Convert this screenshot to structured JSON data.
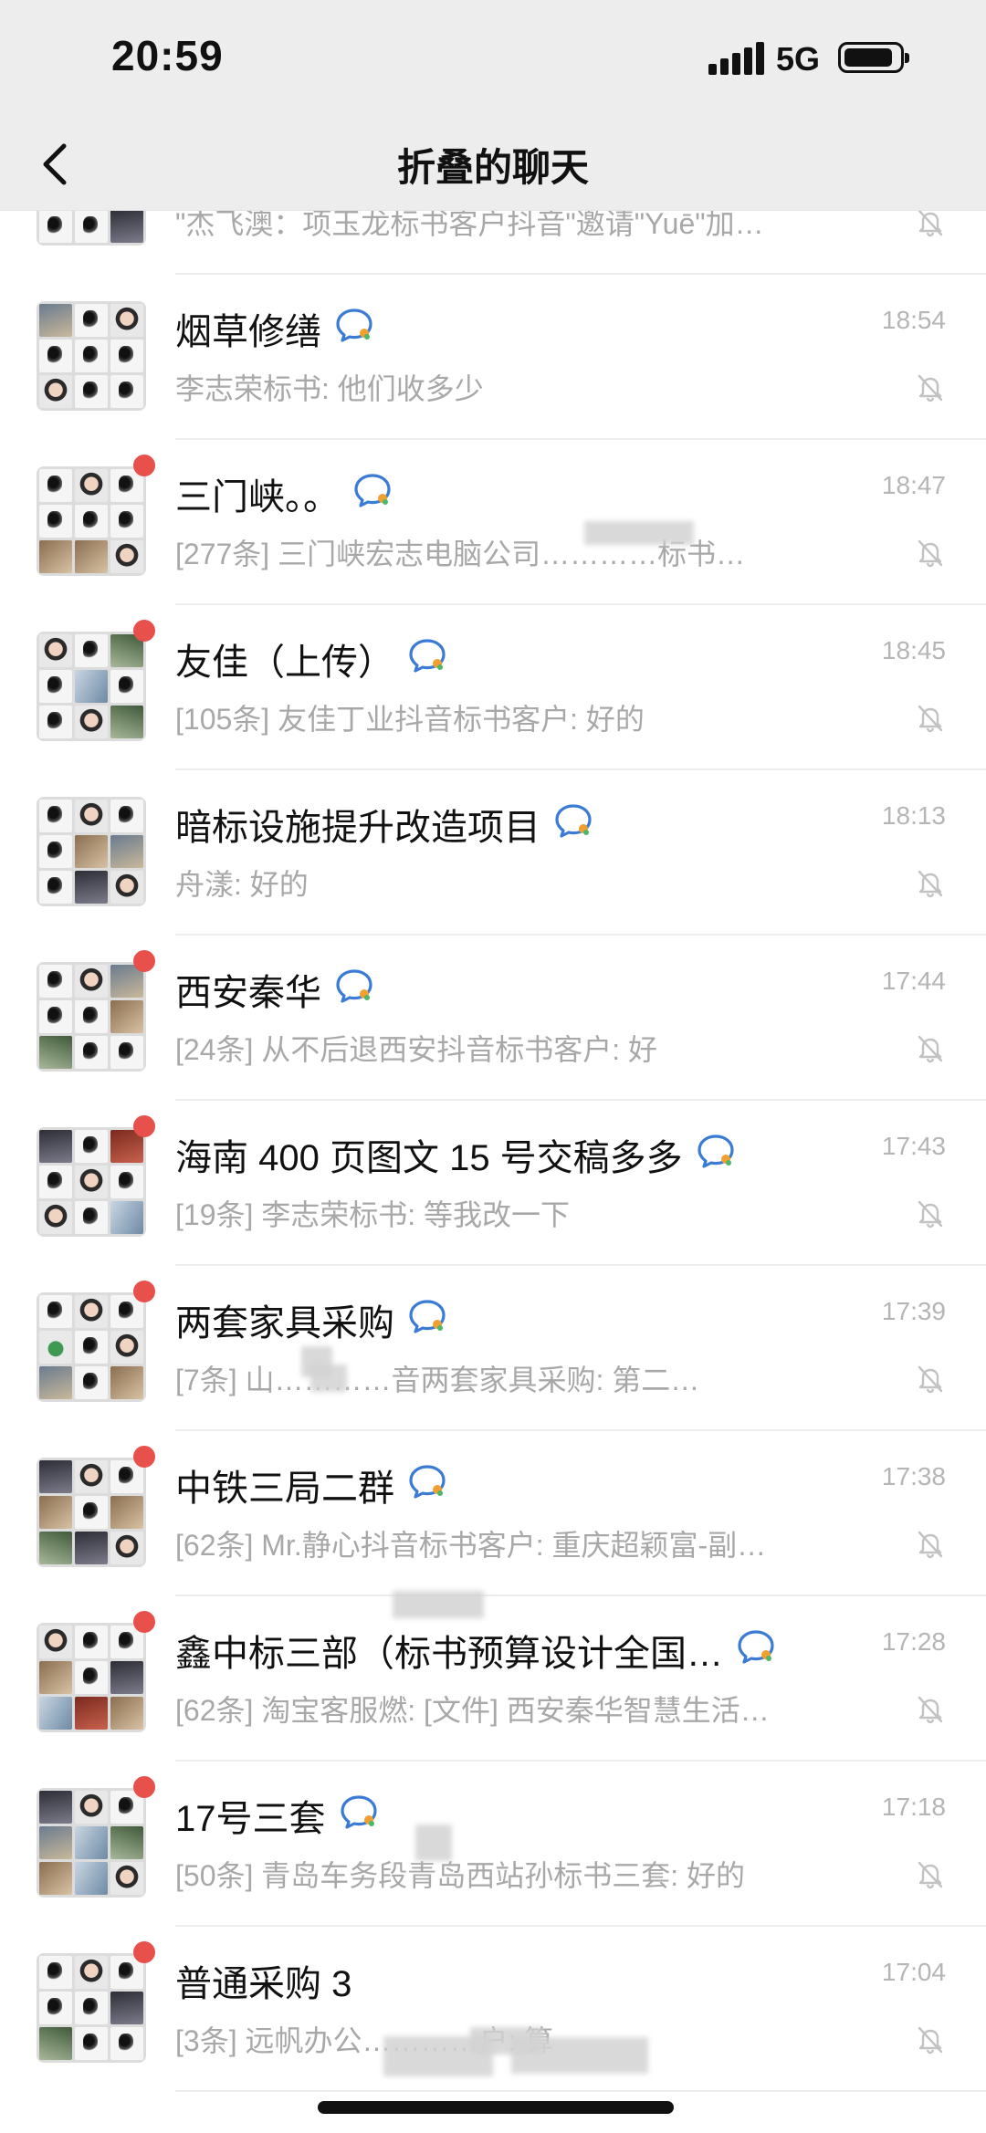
{
  "status_bar": {
    "time": "20:59",
    "network": "5G",
    "icons": [
      "signal-icon",
      "battery-icon"
    ]
  },
  "nav": {
    "title": "折叠的聊天",
    "back_icon": "chevron-left-icon"
  },
  "colors": {
    "unread_dot": "#e8514b",
    "chat_icon_blue": "#3a7bd5",
    "chat_icon_orange": "#f0a030",
    "muted_text": "#a8a8a8"
  },
  "chats": [
    {
      "title": "",
      "preview": "\"杰飞澳：项玉龙标书客户抖音\"邀请\"Yuē\"加…",
      "time": "",
      "unread": false,
      "has_chat_icon": false,
      "muted": true
    },
    {
      "title": "烟草修缮",
      "preview": "李志荣标书: 他们收多少",
      "time": "18:54",
      "unread": false,
      "has_chat_icon": true,
      "muted": true
    },
    {
      "title": "三门峡。。",
      "preview": "[277条] 三门峡宏志电脑公司…………标书…",
      "time": "18:47",
      "unread": true,
      "has_chat_icon": true,
      "muted": true
    },
    {
      "title": "友佳（上传）",
      "preview": "[105条] 友佳丁业抖音标书客户: 好的",
      "time": "18:45",
      "unread": true,
      "has_chat_icon": true,
      "muted": true
    },
    {
      "title": "暗标设施提升改造项目",
      "preview": "舟漾: 好的",
      "time": "18:13",
      "unread": false,
      "has_chat_icon": true,
      "muted": true
    },
    {
      "title": "西安秦华",
      "preview": "[24条] 从不后退西安抖音标书客户: 好",
      "time": "17:44",
      "unread": true,
      "has_chat_icon": true,
      "muted": true
    },
    {
      "title": "海南 400 页图文 15 号交稿多多",
      "preview": "[19条] 李志荣标书: 等我改一下",
      "time": "17:43",
      "unread": true,
      "has_chat_icon": true,
      "muted": true
    },
    {
      "title": "两套家具采购",
      "preview": "[7条] 山…………音两套家具采购: 第二…",
      "time": "17:39",
      "unread": true,
      "has_chat_icon": true,
      "muted": true
    },
    {
      "title": "中铁三局二群",
      "preview": "[62条] Mr.静心抖音标书客户: 重庆超颖富-副…",
      "time": "17:38",
      "unread": true,
      "has_chat_icon": true,
      "muted": true
    },
    {
      "title": "鑫中标三部（标书预算设计全国…",
      "preview": "[62条] 淘宝客服燃: [文件] 西安秦华智慧生活…",
      "time": "17:28",
      "unread": true,
      "has_chat_icon": true,
      "muted": true
    },
    {
      "title": "17号三套",
      "preview": "[50条] 青岛车务段青岛西站孙标书三套: 好的",
      "time": "17:18",
      "unread": true,
      "has_chat_icon": true,
      "muted": true
    },
    {
      "title": "普通采购 3",
      "preview": "[3条] 远帆办公…………户: 算",
      "time": "17:04",
      "unread": true,
      "has_chat_icon": false,
      "muted": true
    }
  ]
}
